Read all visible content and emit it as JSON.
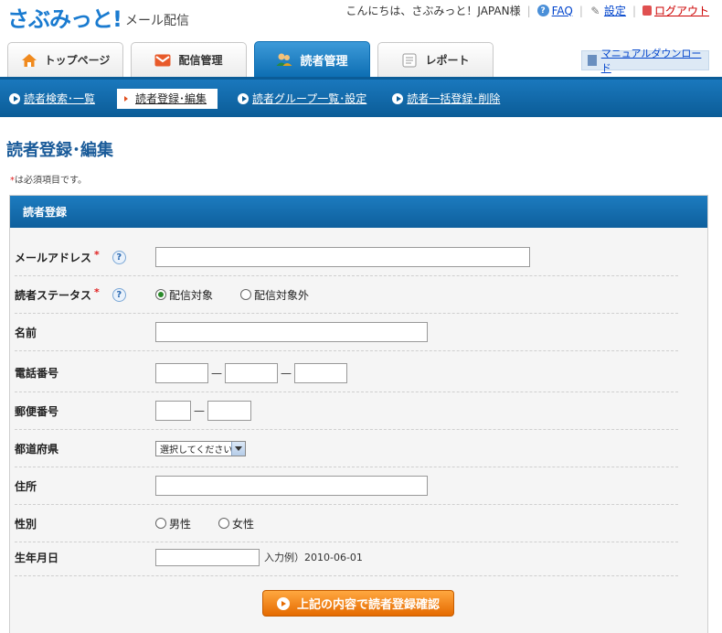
{
  "header": {
    "logo_main": "さぶみっと!",
    "logo_sub": "メール配信",
    "greeting": "こんにちは、さぶみっと！JAPAN様",
    "faq_label": "FAQ",
    "settings_label": "設定",
    "logout_label": "ログアウト"
  },
  "tabs": [
    {
      "label": "トップページ",
      "icon": "home-icon",
      "active": false
    },
    {
      "label": "配信管理",
      "icon": "envelope-icon",
      "active": false
    },
    {
      "label": "読者管理",
      "icon": "readers-icon",
      "active": true
    },
    {
      "label": "レポート",
      "icon": "report-icon",
      "active": false
    }
  ],
  "manual_link": "マニュアルダウンロード",
  "subnav": [
    {
      "label": "読者検索･一覧",
      "active": false
    },
    {
      "label": "読者登録･編集",
      "active": true
    },
    {
      "label": "読者グループ一覧･設定",
      "active": false
    },
    {
      "label": "読者一括登録･削除",
      "active": false
    }
  ],
  "page_title": "読者登録･編集",
  "required_note_mark": "*",
  "required_note_text": "は必須項目です。",
  "panel": {
    "title": "読者登録",
    "fields": {
      "email": {
        "label": "メールアドレス",
        "required_mark": "*",
        "value": ""
      },
      "status": {
        "label": "読者ステータス",
        "required_mark": "*",
        "options": [
          "配信対象",
          "配信対象外"
        ],
        "selected": "配信対象"
      },
      "name": {
        "label": "名前",
        "value": ""
      },
      "phone": {
        "label": "電話番号",
        "dash": "—",
        "values": [
          "",
          "",
          ""
        ]
      },
      "postal": {
        "label": "郵便番号",
        "dash": "—",
        "values": [
          "",
          ""
        ]
      },
      "prefecture": {
        "label": "都道府県",
        "selected": "選択してください"
      },
      "address": {
        "label": "住所",
        "value": ""
      },
      "gender": {
        "label": "性別",
        "options": [
          "男性",
          "女性"
        ],
        "selected": ""
      },
      "birthday": {
        "label": "生年月日",
        "value": "",
        "example": "入力例）2010-06-01"
      }
    },
    "submit_label": "上記の内容で読者登録確認"
  },
  "colors": {
    "brand_blue": "#1a78bd",
    "accent_orange": "#e56a00",
    "required_red": "#e02020"
  }
}
